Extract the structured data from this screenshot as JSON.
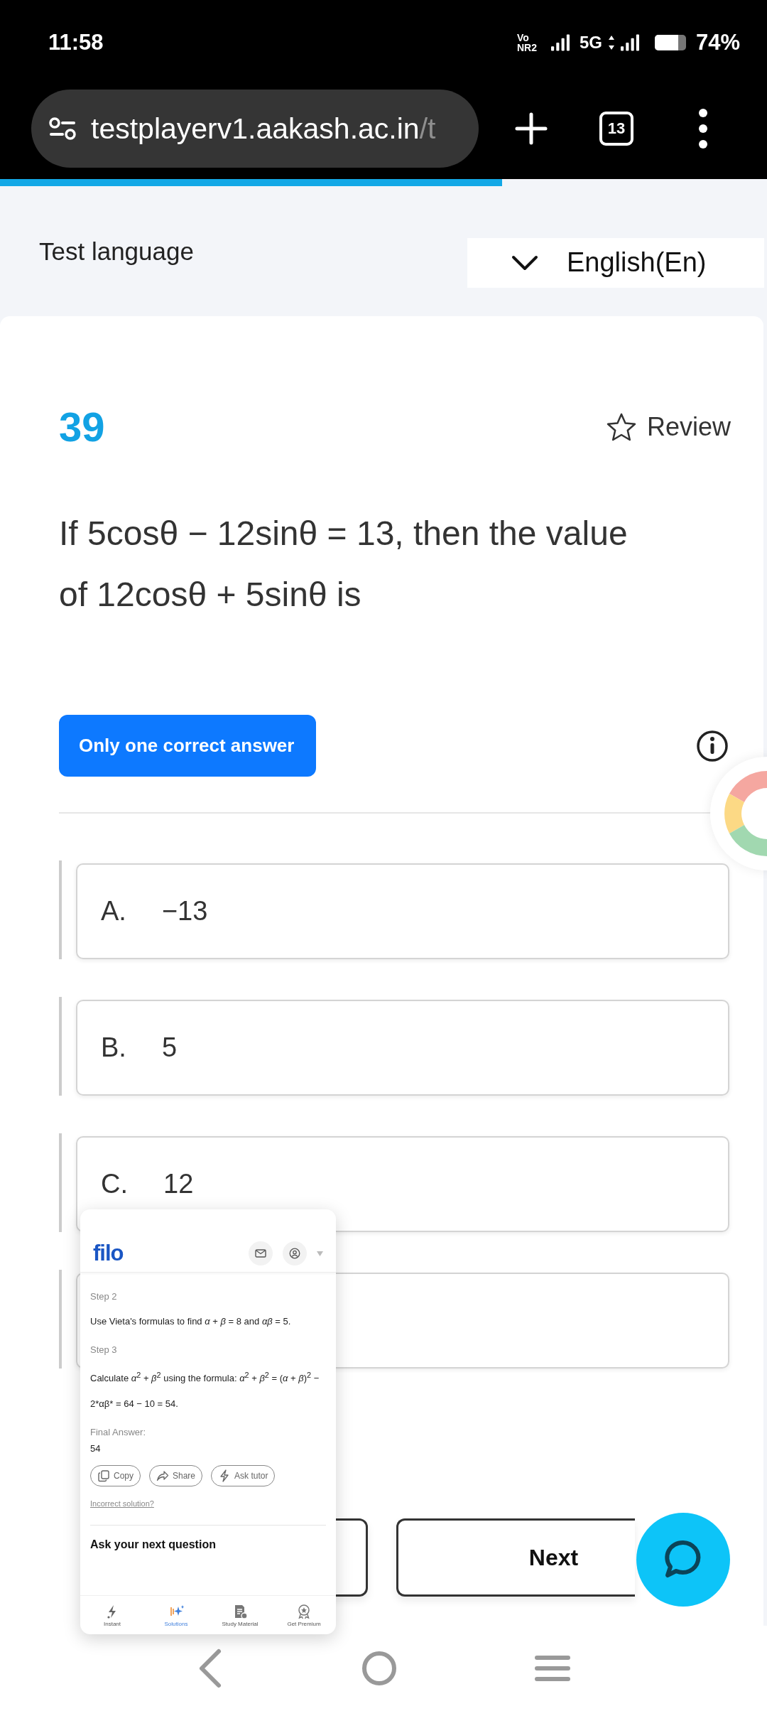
{
  "status_bar": {
    "time": "11:58",
    "volte_top": "Vo",
    "volte_bottom": "NR2",
    "network": "5G",
    "battery": {
      "text": "74%",
      "level": 0.74
    }
  },
  "browser": {
    "url_host": "testplayerv1.aakash.ac.in",
    "url_path": "/t",
    "tab_count": "13",
    "progress": {
      "level": 0.655
    }
  },
  "language": {
    "label": "Test language",
    "value": "English(En)"
  },
  "question": {
    "number": "39",
    "review": "Review",
    "reviewed": false,
    "text": "If 5cosθ − 12sinθ = 13, then the value of 12cosθ + 5sinθ is",
    "answer_type": "Only one correct answer"
  },
  "options": [
    {
      "kind": "shown",
      "letter": "A.",
      "text": "−13"
    },
    {
      "kind": "shown",
      "letter": "B.",
      "text": "5"
    },
    {
      "kind": "shown",
      "letter": "C.",
      "text": "12"
    },
    {
      "kind": "covered"
    }
  ],
  "navigation": [
    {
      "kind": "previous"
    },
    {
      "kind": "next",
      "label": "Next"
    }
  ],
  "filo": {
    "logo": "filo",
    "steps": [
      {
        "title": "Step 2",
        "body": "Use Vieta's formulas to find *α* + *β* = 8 and *αβ* = 5."
      },
      {
        "title": "Step 3",
        "body": "Calculate *α*$^{2}$ + *β*$^{2}$ using the formula: *α*$^{2}$ + *β*$^{2}$ = (*α* + *β*)$^{2}$ − 2*αβ* = 64 − 10 = 54."
      }
    ],
    "final_label": "Final Answer:",
    "final_value": "54",
    "actions": [
      {
        "kind": "copy",
        "label": "Copy"
      },
      {
        "kind": "share",
        "label": "Share"
      },
      {
        "kind": "tutor",
        "label": "Ask tutor"
      }
    ],
    "feedback_link": "Incorrect solution?",
    "ask_heading": "Ask your next question",
    "tabs": [
      {
        "kind": "instant",
        "label": "Instant",
        "selected": false
      },
      {
        "kind": "solutions",
        "label": "Solutions",
        "selected": true
      },
      {
        "kind": "study",
        "label": "Study Material",
        "selected": false
      },
      {
        "kind": "premium",
        "label": "Get Premium",
        "selected": false
      }
    ]
  }
}
